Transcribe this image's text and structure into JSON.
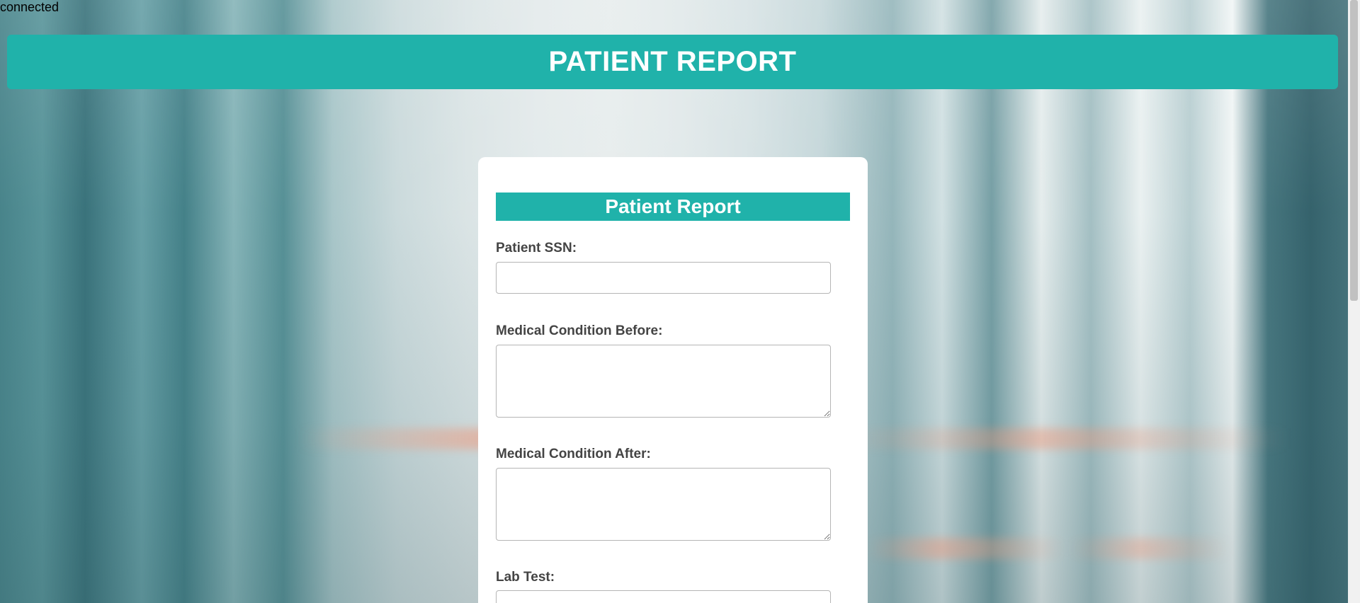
{
  "status": {
    "text": "connected"
  },
  "header": {
    "title": "PATIENT REPORT"
  },
  "form": {
    "title": "Patient Report",
    "fields": {
      "ssn": {
        "label": "Patient SSN:",
        "value": "",
        "placeholder": ""
      },
      "condition_before": {
        "label": "Medical Condition Before:",
        "value": ""
      },
      "condition_after": {
        "label": "Medical Condition After:",
        "value": ""
      },
      "lab_test": {
        "label": "Lab Test:",
        "value": ""
      }
    }
  },
  "colors": {
    "accent": "#20b2aa",
    "card_background": "#ffffff",
    "label_text": "#444444"
  }
}
